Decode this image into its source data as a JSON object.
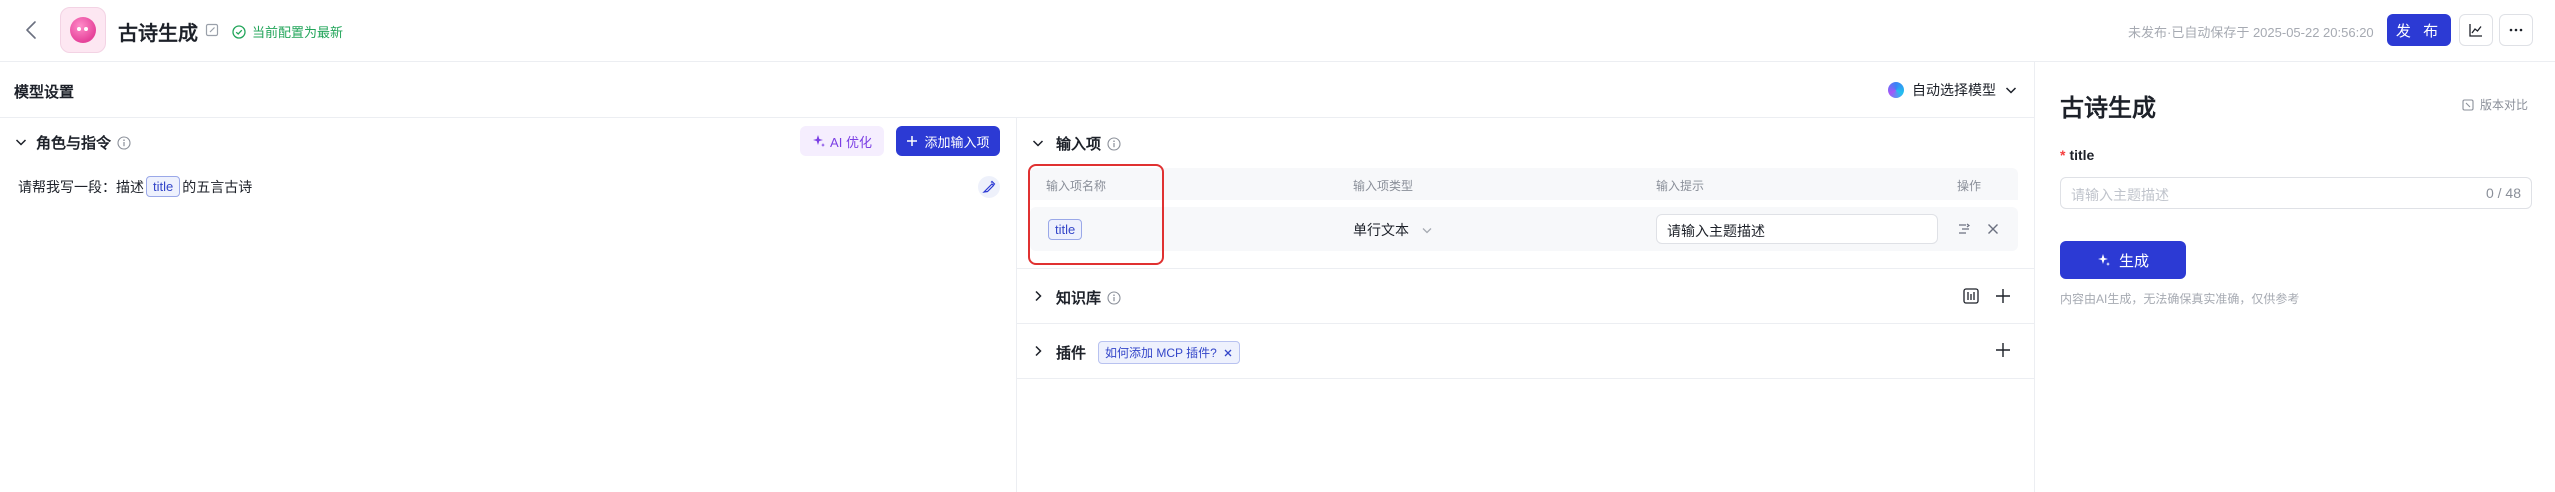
{
  "header": {
    "app_title": "古诗生成",
    "status_text": "当前配置为最新",
    "autosave_text": "未发布·已自动保存于 2025-05-22 20:56:20",
    "publish_label": "发 布"
  },
  "model": {
    "section_title": "模型设置",
    "selected_model": "自动选择模型"
  },
  "role": {
    "title": "角色与指令",
    "ai_optimize_label": "AI 优化",
    "add_input_label": "添加输入项",
    "prompt_before": "请帮我写一段：描述",
    "prompt_var": "title",
    "prompt_after": "的五言古诗"
  },
  "inputs": {
    "title": "输入项",
    "columns": [
      "输入项名称",
      "输入项类型",
      "输入提示",
      "操作"
    ],
    "row": {
      "name": "title",
      "type": "单行文本",
      "hint": "请输入主题描述"
    }
  },
  "knowledge": {
    "title": "知识库"
  },
  "plugins": {
    "title": "插件",
    "tag_label": "如何添加 MCP 插件?"
  },
  "preview": {
    "title": "古诗生成",
    "version_compare": "版本对比",
    "field_label": "title",
    "field_placeholder": "请输入主题描述",
    "field_count": "0 / 48",
    "generate_label": "生成",
    "disclaimer": "内容由AI生成，无法确保真实准确，仅供参考"
  },
  "colors": {
    "primary": "#2c3ad4",
    "success": "#22a55a",
    "highlight": "#e03131",
    "ai_purple": "#7b3fe4"
  }
}
